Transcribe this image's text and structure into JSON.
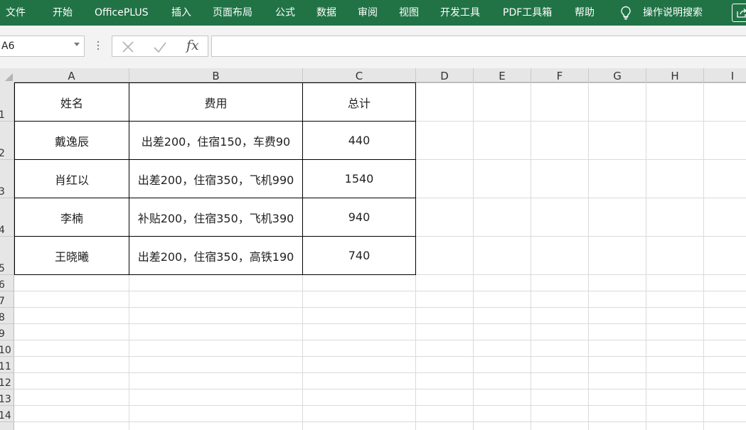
{
  "ribbon": {
    "tabs": [
      "文件",
      "开始",
      "OfficePLUS",
      "插入",
      "页面布局",
      "公式",
      "数据",
      "审阅",
      "视图",
      "开发工具",
      "PDF工具箱",
      "帮助"
    ],
    "search_label": "操作说明搜索",
    "bg_color": "#217346"
  },
  "formula_bar": {
    "name_box": "A6",
    "fx_label": "fx",
    "formula": ""
  },
  "grid": {
    "columns": [
      "A",
      "B",
      "C",
      "D",
      "E",
      "F",
      "G",
      "H",
      "I"
    ],
    "rows": [
      "1",
      "2",
      "3",
      "4",
      "5",
      "6",
      "7",
      "8",
      "9",
      "10",
      "11",
      "12",
      "13",
      "14"
    ]
  },
  "table": {
    "header": [
      "姓名",
      "费用",
      "总计"
    ],
    "rows": [
      [
        "戴逸辰",
        "出差200，住宿150，车费90",
        "440"
      ],
      [
        "肖红以",
        "出差200，住宿350，飞机990",
        "1540"
      ],
      [
        "李楠",
        "补贴200，住宿350，飞机390",
        "940"
      ],
      [
        "王晓曦",
        "出差200，住宿350，高铁190",
        "740"
      ]
    ]
  }
}
